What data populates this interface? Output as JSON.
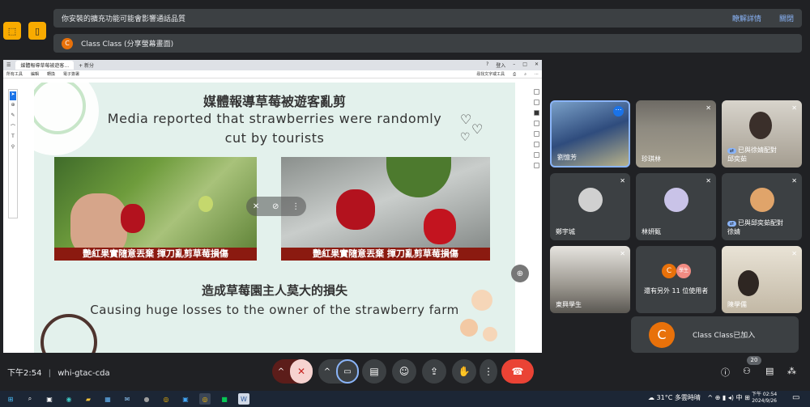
{
  "notice": {
    "message": "你安裝的擴充功能可能會影響通話品質",
    "learn_more": "瞭解詳情",
    "close": "關閉"
  },
  "presenting": {
    "initial": "C",
    "label": "Class Class (分享螢幕畫面)"
  },
  "share": {
    "tab_title": "媒體報導草莓被遊客...",
    "tab_new": "+ 新分",
    "tab_right": [
      "登入"
    ],
    "menu": [
      "所有工具",
      "編輯",
      "轉換",
      "電子簽署"
    ],
    "menu_right": "尋找文字或工具",
    "slide": {
      "title_zh": "媒體報導草莓被遊客亂剪",
      "title_en_line1": "Media reported that strawberries were randomly",
      "title_en_line2": "cut by tourists",
      "caption_left": "艷紅果實隨意丟棄 揮刀亂剪草莓損傷",
      "caption_right": "艷紅果實隨意丟棄 揮刀亂剪草莓損傷",
      "subtitle_zh": "造成草莓園主人莫大的損失",
      "subtitle_en": "Causing huge losses to the owner of the strawberry farm"
    }
  },
  "participants": [
    {
      "name": "劉憶芳"
    },
    {
      "name": "珍琪林"
    },
    {
      "name": "已與徐婧配對",
      "sub": "邱奕茹"
    },
    {
      "name": "鄭宇城"
    },
    {
      "name": "林妍甄"
    },
    {
      "name": "已與邱奕茹配對",
      "sub": "徐婧"
    },
    {
      "name": "東興學生"
    },
    {
      "name": "還有另外 11 位使用者",
      "initial": "C",
      "tag": "學生"
    },
    {
      "name": "陳學儒"
    }
  ],
  "joined": {
    "initial": "C",
    "text": "Class Class已加入"
  },
  "meeting": {
    "time": "下午2:54",
    "code": "whi-gtac-cda"
  },
  "people_count": "20",
  "taskbar": {
    "weather_temp": "31°C",
    "weather_text": "多雲時晴",
    "clock_time": "下午 02:54",
    "clock_date": "2024/9/26",
    "ime": "中"
  },
  "colors": {
    "bg": "#202124",
    "tile": "#3c4043",
    "accent": "#8ab4f8",
    "end_call": "#ea4335",
    "mic_off": "#f6d3d0"
  }
}
